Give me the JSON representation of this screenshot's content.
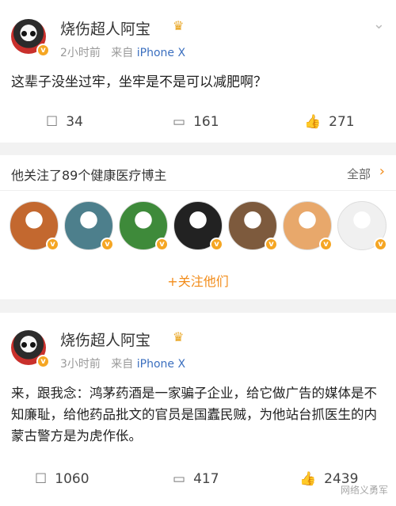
{
  "post1": {
    "username": "烧伤超人阿宝",
    "time": "2小时前",
    "source_prefix": "来自",
    "device": "iPhone X",
    "text": "这辈子没坐过牢，坐牢是不是可以减肥啊？",
    "reposts": "34",
    "comments": "161",
    "likes": "271"
  },
  "recommend": {
    "title": "他关注了89个健康医疗博主",
    "all_label": "全部",
    "follow_label": "+关注他们",
    "avatar_colors": [
      "#c3682f",
      "#4d7f8c",
      "#3e8a3a",
      "#222222",
      "#7d5a3d",
      "#e8a86b",
      "#f0f0f0"
    ]
  },
  "post2": {
    "username": "烧伤超人阿宝",
    "time": "3小时前",
    "source_prefix": "来自",
    "device": "iPhone X",
    "text": "来，跟我念：鸿茅药酒是一家骗子企业，给它做广告的媒体是不知廉耻，给他药品批文的官员是国蠹民贼，为他站台抓医生的内蒙古警方是为虎作伥。",
    "reposts": "1060",
    "comments": "417",
    "likes": "2439"
  },
  "watermark": "网络义勇军",
  "icons": {
    "repost": "repost-icon",
    "comment": "comment-icon",
    "like": "thumbs-up-icon",
    "more": "chevron-down-icon",
    "crown": "crown-icon"
  }
}
